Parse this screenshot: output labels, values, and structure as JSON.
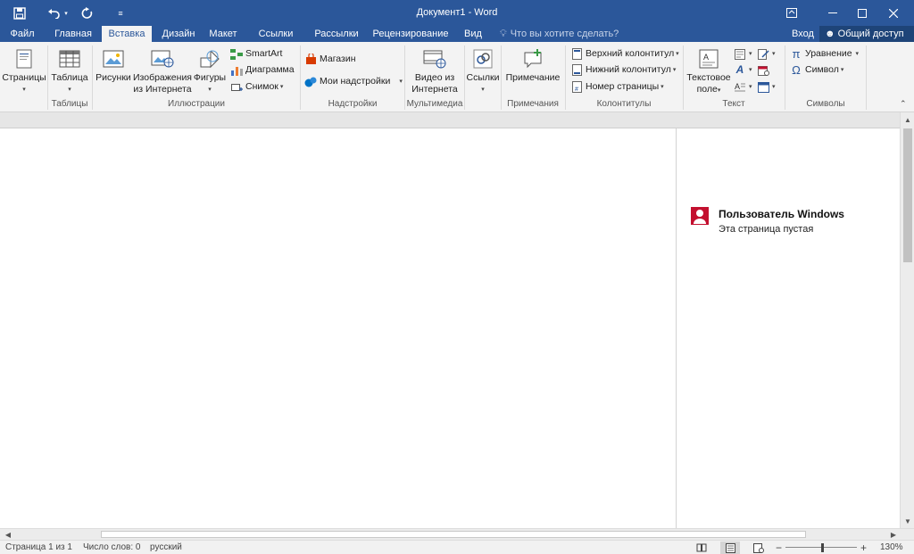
{
  "titlebar": {
    "title": "Документ1 - Word",
    "save_icon": "save-icon",
    "undo_icon": "undo-icon",
    "redo_icon": "redo-icon",
    "customize_icon": "customize-qat-icon",
    "colors": {
      "brand": "#2b579a"
    }
  },
  "tabs": {
    "items": [
      "Файл",
      "Главная",
      "Вставка",
      "Дизайн",
      "Макет",
      "Ссылки",
      "Рассылки",
      "Рецензирование",
      "Вид"
    ],
    "active": "Вставка",
    "tell_me": "Что вы хотите сделать?",
    "sign_in": "Вход",
    "share": "Общий доступ"
  },
  "ribbon": {
    "pages": {
      "label": "Страницы",
      "group": ""
    },
    "tables": {
      "label": "Таблица",
      "group": "Таблицы"
    },
    "illustrations": {
      "pictures": "Рисунки",
      "online_pictures_1": "Изображения",
      "online_pictures_2": "из Интернета",
      "shapes": "Фигуры",
      "smartart": "SmartArt",
      "chart": "Диаграмма",
      "screenshot": "Снимок",
      "group": "Иллюстрации"
    },
    "addins": {
      "store": "Магазин",
      "my_addins": "Мои надстройки",
      "group": "Надстройки"
    },
    "media": {
      "video_1": "Видео из",
      "video_2": "Интернета",
      "group": "Мультимедиа"
    },
    "links": {
      "label": "Ссылки",
      "group": ""
    },
    "comments": {
      "label": "Примечание",
      "group": "Примечания"
    },
    "header_footer": {
      "header": "Верхний колонтитул",
      "footer": "Нижний колонтитул",
      "page_number": "Номер страницы",
      "group": "Колонтитулы"
    },
    "text": {
      "textbox_1": "Текстовое",
      "textbox_2": "поле",
      "group": "Текст"
    },
    "symbols": {
      "equation": "Уравнение",
      "symbol": "Символ",
      "group": "Символы"
    }
  },
  "comment": {
    "author": "Пользователь Windows",
    "text": "Эта страница пустая",
    "avatar_color": "#c3102f"
  },
  "statusbar": {
    "page": "Страница 1 из 1",
    "words": "Число слов: 0",
    "language": "русский",
    "zoom": "130%",
    "zoom_minus": "−",
    "zoom_plus": "+"
  }
}
